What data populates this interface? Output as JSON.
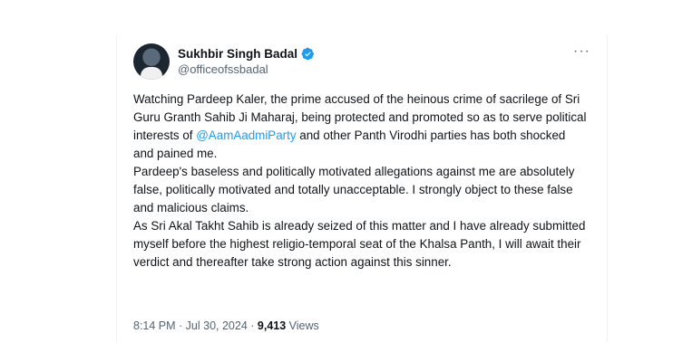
{
  "author": {
    "display_name": "Sukhbir Singh Badal",
    "handle": "@officeofssbadal",
    "verified_color": "#1d9bf0"
  },
  "more_menu": {
    "label": "···"
  },
  "tweet": {
    "line1_prefix": "Watching Pardeep Kaler, the prime accused of the heinous crime of sacrilege of Sri Guru Granth Sahib Ji Maharaj, being protected and promoted so as to serve political interests of ",
    "mention": "@AamAadmiParty",
    "line1_suffix": " and other Panth Virodhi parties has both shocked and pained me.",
    "paragraph2": "Pardeep's baseless and politically motivated allegations against me are absolutely false, politically motivated and totally unacceptable. I strongly object to these false and malicious claims.",
    "paragraph3": "As Sri Akal Takht Sahib is already seized of this matter and I have already submitted myself before  the highest religio-temporal seat of the Khalsa Panth, I will await their verdict and thereafter take strong action against this sinner."
  },
  "meta": {
    "time": "8:14 PM",
    "separator": " · ",
    "date": "Jul 30, 2024",
    "views_count": "9,413",
    "views_label": " Views"
  }
}
